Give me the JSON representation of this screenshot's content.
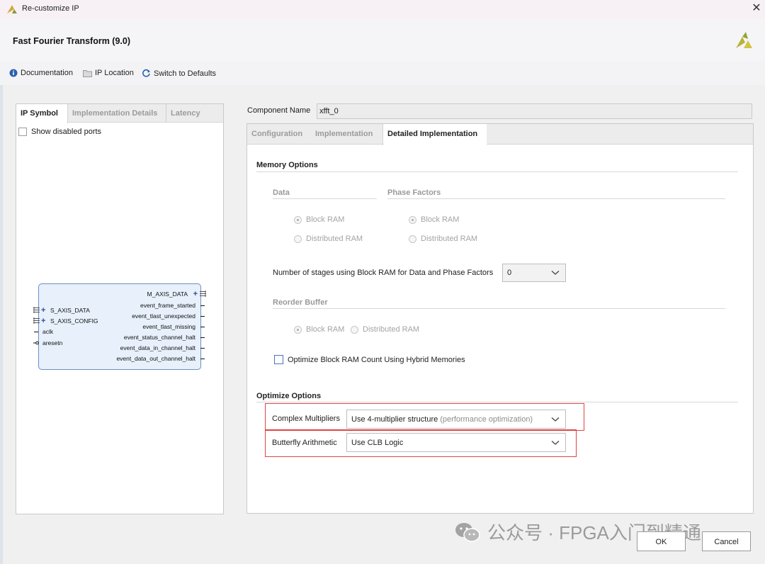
{
  "window": {
    "title": "Re-customize IP",
    "ip_title": "Fast Fourier Transform (9.0)"
  },
  "toolbar": {
    "documentation": "Documentation",
    "ip_location": "IP Location",
    "switch_defaults": "Switch to Defaults"
  },
  "left_panel": {
    "tabs": [
      "IP Symbol",
      "Implementation Details",
      "Latency"
    ],
    "show_disabled_ports": "Show disabled ports",
    "ip_symbol": {
      "left_ports": [
        "S_AXIS_DATA",
        "S_AXIS_CONFIG",
        "aclk",
        "aresetn"
      ],
      "right_ports": [
        "M_AXIS_DATA",
        "event_frame_started",
        "event_tlast_unexpected",
        "event_tlast_missing",
        "event_status_channel_halt",
        "event_data_in_channel_halt",
        "event_data_out_channel_halt"
      ]
    }
  },
  "component": {
    "label": "Component Name",
    "value": "xfft_0"
  },
  "right_panel": {
    "tabs": [
      "Configuration",
      "Implementation",
      "Detailed Implementation"
    ],
    "memory_options": {
      "title": "Memory Options",
      "data_title": "Data",
      "phase_title": "Phase Factors",
      "data_opts": [
        "Block RAM",
        "Distributed RAM"
      ],
      "phase_opts": [
        "Block RAM",
        "Distributed RAM"
      ],
      "stages_label": "Number of stages using Block RAM for Data and Phase Factors",
      "stages_value": "0",
      "reorder_title": "Reorder Buffer",
      "reorder_opts": [
        "Block RAM",
        "Distributed RAM"
      ],
      "hybrid_label": "Optimize Block RAM Count Using Hybrid Memories"
    },
    "optimize_options": {
      "title": "Optimize Options",
      "complex_label": "Complex Multipliers",
      "complex_value": "Use 4-multiplier structure",
      "complex_hint": "(performance optimization)",
      "butterfly_label": "Butterfly Arithmetic",
      "butterfly_value": "Use CLB Logic"
    }
  },
  "footer": {
    "watermark": "公众号 · FPGA入门到精通",
    "ok": "OK",
    "cancel": "Cancel"
  },
  "colors": {
    "highlight_red": "#e04545",
    "xilinx_yellow": "#c9b82c",
    "info_blue": "#2b5fae"
  }
}
